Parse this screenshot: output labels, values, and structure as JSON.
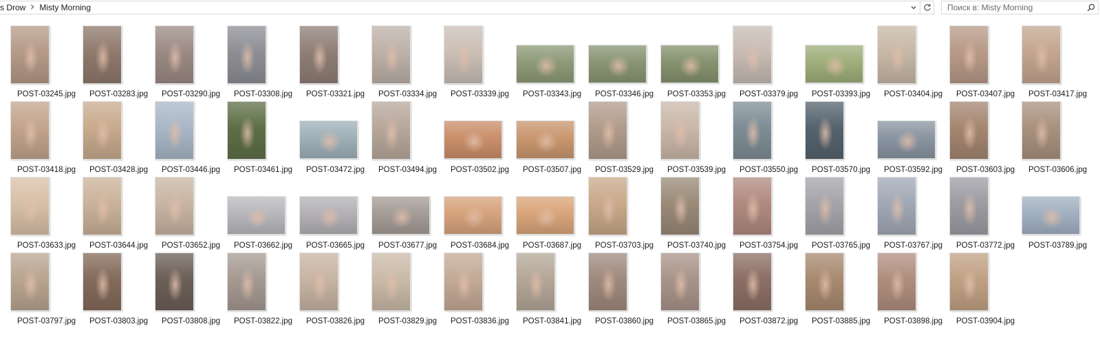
{
  "address_bar": {
    "crumbs": [
      "s Drow",
      "Misty Morning"
    ],
    "separator_icon": "chevron-right-icon",
    "dropdown_icon": "chevron-down-icon",
    "refresh_icon": "refresh-icon"
  },
  "search": {
    "placeholder": "Поиск в: Misty Morning",
    "icon": "search-icon"
  },
  "files": [
    "POST-03245.jpg",
    "POST-03283.jpg",
    "POST-03290.jpg",
    "POST-03308.jpg",
    "POST-03321.jpg",
    "POST-03334.jpg",
    "POST-03339.jpg",
    "POST-03343.jpg",
    "POST-03346.jpg",
    "POST-03353.jpg",
    "POST-03379.jpg",
    "POST-03393.jpg",
    "POST-03404.jpg",
    "POST-03407.jpg",
    "POST-03417.jpg",
    "POST-03418.jpg",
    "POST-03428.jpg",
    "POST-03446.jpg",
    "POST-03461.jpg",
    "POST-03472.jpg",
    "POST-03494.jpg",
    "POST-03502.jpg",
    "POST-03507.jpg",
    "POST-03529.jpg",
    "POST-03539.jpg",
    "POST-03550.jpg",
    "POST-03570.jpg",
    "POST-03592.jpg",
    "POST-03603.jpg",
    "POST-03606.jpg",
    "POST-03633.jpg",
    "POST-03644.jpg",
    "POST-03652.jpg",
    "POST-03662.jpg",
    "POST-03665.jpg",
    "POST-03677.jpg",
    "POST-03684.jpg",
    "POST-03687.jpg",
    "POST-03703.jpg",
    "POST-03740.jpg",
    "POST-03754.jpg",
    "POST-03765.jpg",
    "POST-03767.jpg",
    "POST-03772.jpg",
    "POST-03789.jpg",
    "POST-03797.jpg",
    "POST-03803.jpg",
    "POST-03808.jpg",
    "POST-03822.jpg",
    "POST-03826.jpg",
    "POST-03829.jpg",
    "POST-03836.jpg",
    "POST-03841.jpg",
    "POST-03860.jpg",
    "POST-03865.jpg",
    "POST-03872.jpg",
    "POST-03885.jpg",
    "POST-03898.jpg",
    "POST-03904.jpg"
  ],
  "thumb_orientation": [
    "p",
    "p",
    "p",
    "p",
    "p",
    "p",
    "p",
    "l",
    "l",
    "l",
    "p",
    "l",
    "p",
    "p",
    "p",
    "p",
    "p",
    "p",
    "p",
    "l",
    "p",
    "l",
    "l",
    "p",
    "p",
    "p",
    "p",
    "l",
    "p",
    "p",
    "p",
    "p",
    "p",
    "l",
    "l",
    "l",
    "l",
    "l",
    "p",
    "p",
    "p",
    "p",
    "p",
    "p",
    "l",
    "p",
    "p",
    "p",
    "p",
    "p",
    "p",
    "p",
    "p",
    "p",
    "p",
    "p",
    "p",
    "p",
    "p"
  ],
  "thumb_palette": [
    "#b59a88",
    "#8f7a6c",
    "#9b8a84",
    "#8d8f95",
    "#8f7f76",
    "#bdb1a8",
    "#cbbfb6",
    "#8e9a78",
    "#899574",
    "#86926f",
    "#c8bcb4",
    "#9fae7a",
    "#c7b8a6",
    "#b89a88",
    "#c4a690",
    "#c2a48c",
    "#c9ab8e",
    "#a9b7c7",
    "#5e6f47",
    "#9fb0b8",
    "#b8a89c",
    "#c98f6a",
    "#c9976f",
    "#b19c8c",
    "#cab8aa",
    "#7f8d95",
    "#55636e",
    "#8a95a2",
    "#a48670",
    "#a9917e",
    "#d8c0a8",
    "#cbb29a",
    "#c8b5a3",
    "#b7b7bd",
    "#b3b1b5",
    "#a49c96",
    "#d6a37c",
    "#d9a57a",
    "#c9a98a",
    "#9a8a78",
    "#b08a80",
    "#a4a4aa",
    "#a1a9b6",
    "#9d9ca3",
    "#a2b0c1",
    "#b9a590",
    "#846a5a",
    "#6b5f57",
    "#a59a92",
    "#c7b4a3",
    "#cabaa8",
    "#c4aa96",
    "#b4a798",
    "#9f8a7e",
    "#a9948a",
    "#8c6f66",
    "#a88a70",
    "#b08e7e",
    "#c1a184"
  ]
}
